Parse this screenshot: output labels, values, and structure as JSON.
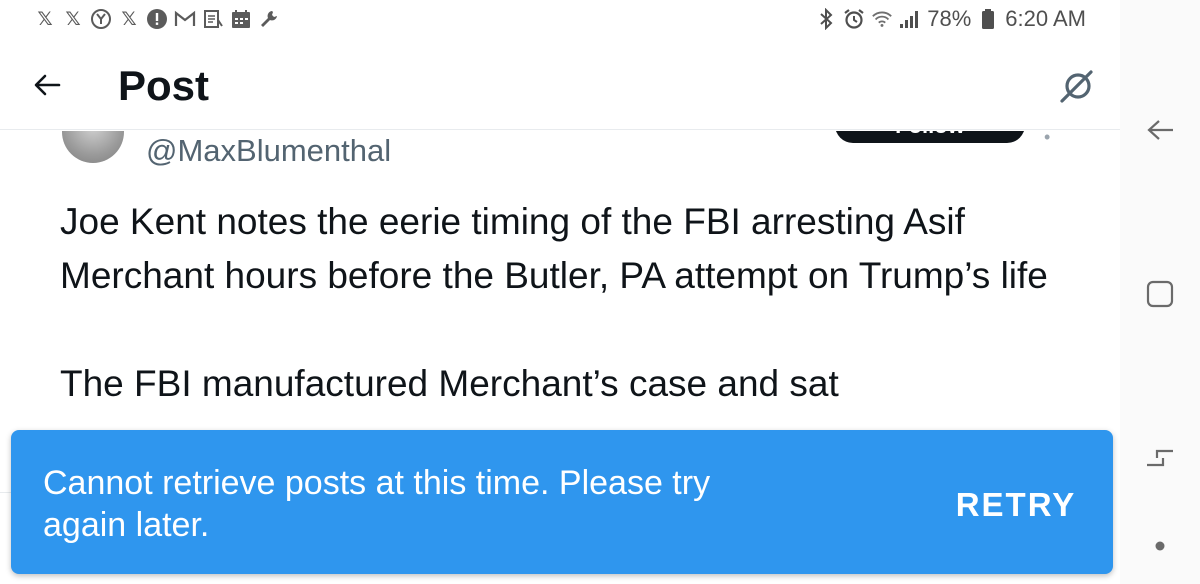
{
  "status_bar": {
    "left_icons": [
      "x-logo-icon",
      "x-logo-icon",
      "circled-y-icon",
      "x-logo-icon",
      "alert-circle-icon",
      "gmail-icon",
      "news-icon",
      "calendar-icon",
      "wrench-icon"
    ],
    "battery_percent": "78%",
    "time": "6:20 AM"
  },
  "header": {
    "title": "Post"
  },
  "post": {
    "handle": "@MaxBlumenthal",
    "follow_label": "Follow",
    "paragraph_1": "Joe Kent notes the eerie timing of the FBI arresting Asif Merchant hours before the Butler, PA attempt on Trump’s life",
    "paragraph_2_partial": "The FBI manufactured Merchant’s case and sat"
  },
  "snackbar": {
    "message": "Cannot retrieve posts at this time. Please try again later.",
    "action_label": "RETRY",
    "background_color": "#2f96ee"
  },
  "colors": {
    "text_primary": "#0f1419",
    "text_secondary": "#536471"
  }
}
